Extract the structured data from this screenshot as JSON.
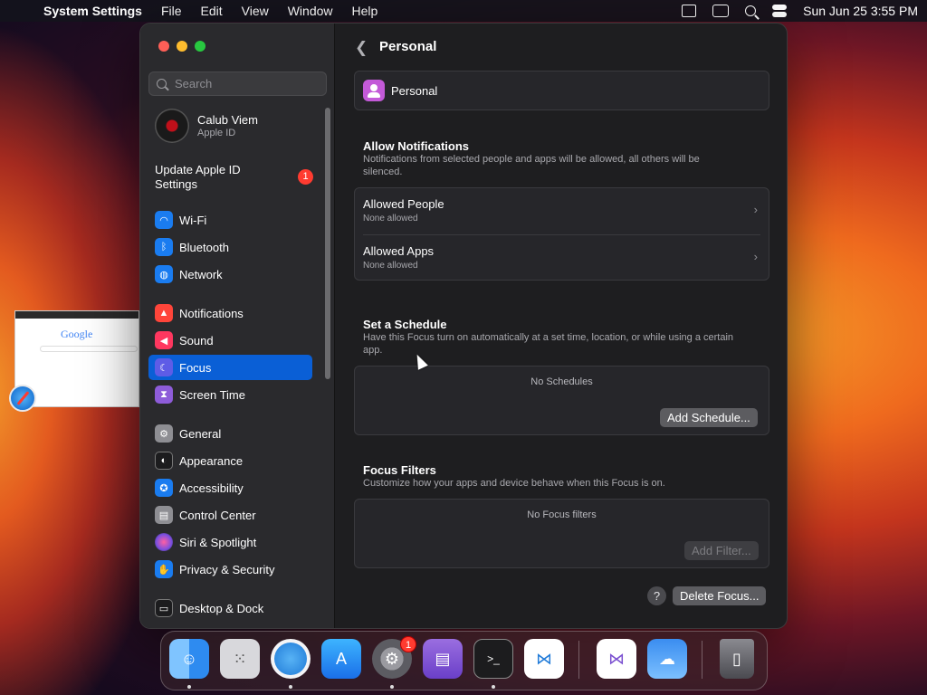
{
  "menubar": {
    "app_name": "System Settings",
    "menus": [
      "File",
      "Edit",
      "View",
      "Window",
      "Help"
    ],
    "datetime": "Sun Jun 25  3:55 PM"
  },
  "sidebar": {
    "search_placeholder": "Search",
    "user": {
      "name": "Calub Viem",
      "sub": "Apple ID"
    },
    "update": {
      "label": "Update Apple ID Settings",
      "badge": "1"
    },
    "items": [
      {
        "label": "Wi-Fi",
        "icon": "wifi-icon",
        "color": "#1a7cf0"
      },
      {
        "label": "Bluetooth",
        "icon": "bluetooth-icon",
        "color": "#1a7cf0"
      },
      {
        "label": "Network",
        "icon": "globe-icon",
        "color": "#1a7cf0"
      },
      {
        "label": "Notifications",
        "icon": "bell-icon",
        "color": "#ff453a"
      },
      {
        "label": "Sound",
        "icon": "speaker-icon",
        "color": "#ff375f"
      },
      {
        "label": "Focus",
        "icon": "moon-icon",
        "color": "#5e5ce6"
      },
      {
        "label": "Screen Time",
        "icon": "hourglass-icon",
        "color": "#8e5cd9"
      },
      {
        "label": "General",
        "icon": "gear-icon",
        "color": "#8e8e93"
      },
      {
        "label": "Appearance",
        "icon": "appearance-icon",
        "color": "#1c1c1e"
      },
      {
        "label": "Accessibility",
        "icon": "accessibility-icon",
        "color": "#1a7cf0"
      },
      {
        "label": "Control Center",
        "icon": "control-center-icon",
        "color": "#8e8e93"
      },
      {
        "label": "Siri & Spotlight",
        "icon": "siri-icon",
        "color": "#b34fd8"
      },
      {
        "label": "Privacy & Security",
        "icon": "hand-icon",
        "color": "#1a7cf0"
      },
      {
        "label": "Desktop & Dock",
        "icon": "dock-icon",
        "color": "#1c1c1e"
      }
    ]
  },
  "main": {
    "title": "Personal",
    "focus_name": "Personal",
    "allow_notifications": {
      "title": "Allow Notifications",
      "desc": "Notifications from selected people and apps will be allowed, all others will be silenced.",
      "rows": [
        {
          "title": "Allowed People",
          "sub": "None allowed"
        },
        {
          "title": "Allowed Apps",
          "sub": "None allowed"
        }
      ]
    },
    "schedule": {
      "title": "Set a Schedule",
      "desc": "Have this Focus turn on automatically at a set time, location, or while using a certain app.",
      "empty": "No Schedules",
      "button": "Add Schedule..."
    },
    "filters": {
      "title": "Focus Filters",
      "desc": "Customize how your apps and device behave when this Focus is on.",
      "empty": "No Focus filters",
      "button": "Add Filter..."
    },
    "help": "?",
    "delete_button": "Delete Focus..."
  },
  "thumbnail": {
    "logo": "Google"
  },
  "dock": {
    "settings_badge": "1",
    "apps": [
      {
        "name": "finder-icon",
        "color": "#2e8bf0"
      },
      {
        "name": "launchpad-icon",
        "color": "#d8d8dc"
      },
      {
        "name": "safari-icon",
        "color": "#1f8bf0"
      },
      {
        "name": "app-store-icon",
        "color": "#1e7ff0"
      },
      {
        "name": "system-settings-icon",
        "color": "#8e8e93"
      },
      {
        "name": "apple-configurator-icon",
        "color": "#7a4fd0"
      },
      {
        "name": "terminal-icon",
        "color": "#1c1c1e"
      },
      {
        "name": "vscode-icon",
        "color": "#ffffff"
      },
      {
        "name": "visual-studio-icon",
        "color": "#ffffff"
      },
      {
        "name": "weather-icon",
        "color": "#3a8df0"
      },
      {
        "name": "trash-icon",
        "color": "#6e6e72"
      }
    ]
  }
}
